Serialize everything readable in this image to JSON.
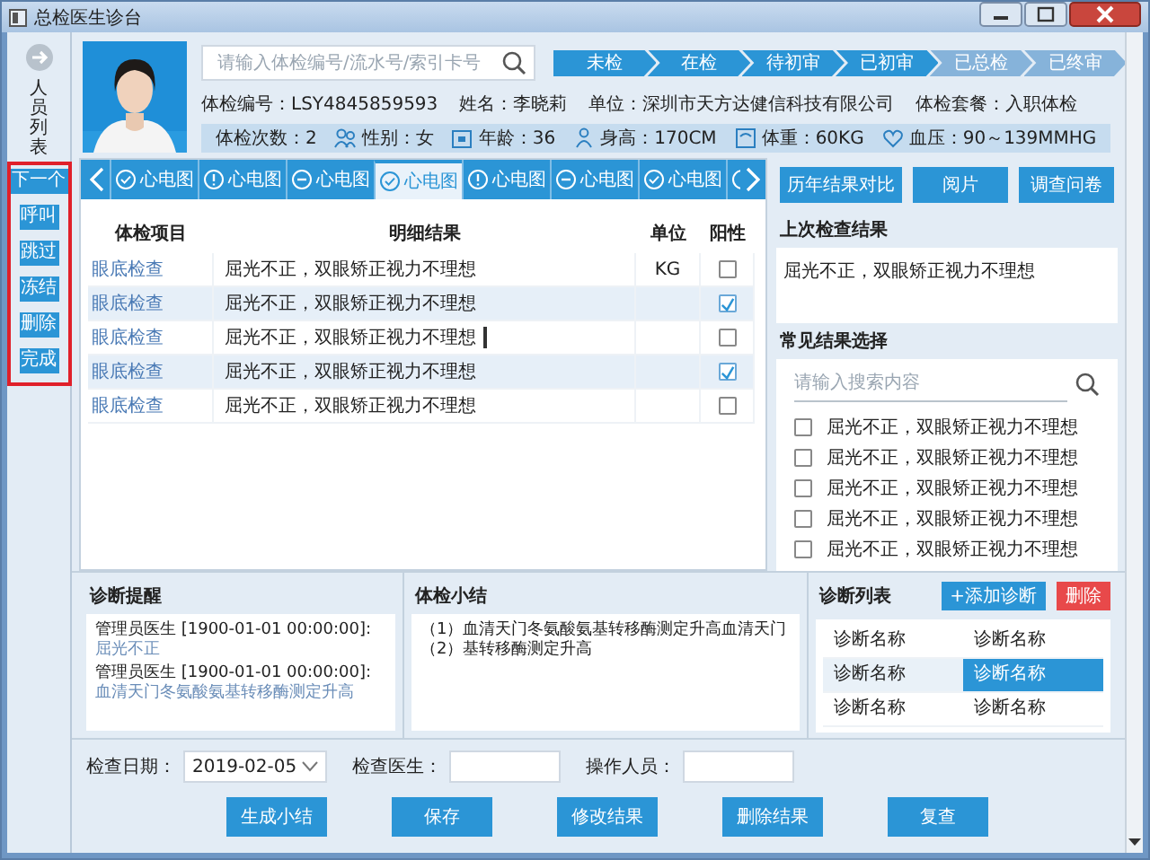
{
  "window": {
    "title": "总检医生诊台"
  },
  "sidebar": {
    "title": "人员列表",
    "buttons": [
      "下一个",
      "呼叫",
      "跳过",
      "冻结",
      "删除",
      "完成"
    ]
  },
  "photo": {
    "kind": "picture"
  },
  "search": {
    "placeholder": "请输入体检编号/流水号/索引卡号"
  },
  "steps": [
    {
      "label": "未检",
      "done": true
    },
    {
      "label": "在检",
      "done": true
    },
    {
      "label": "待初审",
      "done": true
    },
    {
      "label": "已初审",
      "done": true
    },
    {
      "label": "已总检",
      "done": false
    },
    {
      "label": "已终审",
      "done": false
    }
  ],
  "info": [
    "体检编号：LSY4845859593",
    "姓名：李晓莉",
    "单位：深圳市天方达健信科技有限公司",
    "体检套餐：入职体检"
  ],
  "stats": [
    {
      "kind": "plain",
      "text": "体检次数：2"
    },
    {
      "kind": "gender",
      "text": "性别：女"
    },
    {
      "kind": "age",
      "text": "年龄：36"
    },
    {
      "kind": "height",
      "text": "身高：170CM"
    },
    {
      "kind": "weight",
      "text": "体重：60KG"
    },
    {
      "kind": "pressure",
      "text": "血压：90～139MMHG"
    }
  ],
  "tabs": [
    {
      "kind": "done",
      "label": "心电图",
      "selected": false
    },
    {
      "kind": "warning",
      "label": "心电图",
      "selected": false
    },
    {
      "kind": "skipped",
      "label": "心电图",
      "selected": false
    },
    {
      "kind": "done",
      "label": "心电图",
      "selected": true
    },
    {
      "kind": "warning",
      "label": "心电图",
      "selected": false
    },
    {
      "kind": "skipped",
      "label": "心电图",
      "selected": false
    },
    {
      "kind": "done",
      "label": "心电图",
      "selected": false
    },
    {
      "kind": "warning",
      "selected": false
    }
  ],
  "table": {
    "columns": [
      "体检项目",
      "明细结果",
      "单位",
      "阳性"
    ],
    "rows": [
      {
        "item": "眼底检查",
        "result": "屈光不正，双眼矫正视力不理想",
        "unit": "KG",
        "positive": false,
        "editing": false
      },
      {
        "item": "眼底检查",
        "result": "屈光不正，双眼矫正视力不理想",
        "positive": true,
        "editing": false
      },
      {
        "item": "眼底检查",
        "result": "屈光不正，双眼矫正视力不理想",
        "positive": false,
        "editing": true
      },
      {
        "item": "眼底检查",
        "result": "屈光不正，双眼矫正视力不理想",
        "positive": true,
        "editing": false
      },
      {
        "item": "眼底检查",
        "result": "屈光不正，双眼矫正视力不理想",
        "positive": false,
        "editing": false
      }
    ]
  },
  "side_buttons": [
    "历年结果对比",
    "阅片",
    "调查问卷"
  ],
  "last_result": {
    "title": "上次检查结果",
    "text": "屈光不正，双眼矫正视力不理想"
  },
  "common": {
    "title": "常见结果选择",
    "placeholder": "请输入搜索内容",
    "items": [
      {
        "label": "屈光不正，双眼矫正视力不理想",
        "checked": false
      },
      {
        "label": "屈光不正，双眼矫正视力不理想",
        "checked": false
      },
      {
        "label": "屈光不正，双眼矫正视力不理想",
        "checked": false
      },
      {
        "label": "屈光不正，双眼矫正视力不理想",
        "checked": false
      },
      {
        "label": "屈光不正，双眼矫正视力不理想",
        "checked": false
      }
    ]
  },
  "reminders": {
    "title": "诊断提醒",
    "entries": [
      {
        "author": "管理员医生 [1900-01-01 00:00:00]:",
        "note": "屈光不正"
      },
      {
        "author": "管理员医生 [1900-01-01 00:00:00]:",
        "note": "血清天门冬氨酸氨基转移酶测定升高"
      }
    ]
  },
  "summary": {
    "title": "体检小结",
    "lines": [
      "（1）血清天门冬氨酸氨基转移酶测定升高血清天门",
      "（2）基转移酶测定升高"
    ]
  },
  "diagnoses": {
    "title": "诊断列表",
    "add": "+添加诊断",
    "delete": "删除",
    "rows": [
      [
        {
          "text": "诊断名称",
          "selected": false
        },
        {
          "text": "诊断名称",
          "selected": false
        }
      ],
      [
        {
          "text": "诊断名称",
          "selected": false
        },
        {
          "text": "诊断名称",
          "selected": true
        }
      ],
      [
        {
          "text": "诊断名称",
          "selected": false
        },
        {
          "text": "诊断名称",
          "selected": false
        }
      ]
    ]
  },
  "form": [
    {
      "label": "检查日期：",
      "value": "2019-02-05",
      "kind": "date"
    },
    {
      "label": "检查医生：",
      "kind": "text"
    },
    {
      "label": "操作人员：",
      "kind": "text"
    }
  ],
  "actions": [
    "生成小结",
    "保存",
    "修改结果",
    "删除结果",
    "复查"
  ]
}
